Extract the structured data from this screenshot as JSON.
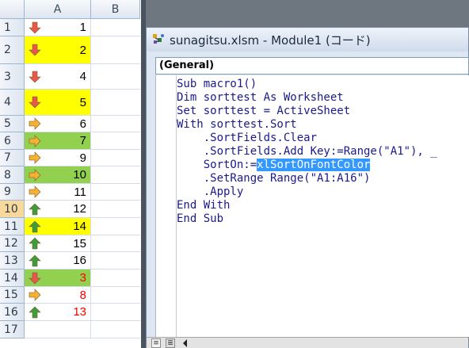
{
  "spreadsheet": {
    "corner": "",
    "columns": [
      "A",
      "B"
    ],
    "rows": [
      {
        "num": "1",
        "value": "1",
        "arrow": "down",
        "fill": "#ffffff",
        "color": "#000000"
      },
      {
        "num": "2",
        "value": "2",
        "arrow": "down",
        "fill": "#ffff00",
        "color": "#000000"
      },
      {
        "num": "3",
        "value": "4",
        "arrow": "down",
        "fill": "#ffffff",
        "color": "#000000"
      },
      {
        "num": "4",
        "value": "5",
        "arrow": "down",
        "fill": "#ffff00",
        "color": "#000000"
      },
      {
        "num": "5",
        "value": "6",
        "arrow": "right",
        "fill": "#ffffff",
        "color": "#000000"
      },
      {
        "num": "6",
        "value": "7",
        "arrow": "right",
        "fill": "#92d050",
        "color": "#000000"
      },
      {
        "num": "7",
        "value": "9",
        "arrow": "right",
        "fill": "#ffffff",
        "color": "#000000"
      },
      {
        "num": "8",
        "value": "10",
        "arrow": "right",
        "fill": "#92d050",
        "color": "#000000"
      },
      {
        "num": "9",
        "value": "11",
        "arrow": "right",
        "fill": "#ffffff",
        "color": "#000000"
      },
      {
        "num": "10",
        "value": "12",
        "arrow": "up",
        "fill": "#ffffff",
        "color": "#000000"
      },
      {
        "num": "11",
        "value": "14",
        "arrow": "up",
        "fill": "#ffff00",
        "color": "#000000"
      },
      {
        "num": "12",
        "value": "15",
        "arrow": "up",
        "fill": "#ffffff",
        "color": "#000000"
      },
      {
        "num": "13",
        "value": "16",
        "arrow": "up",
        "fill": "#ffffff",
        "color": "#000000"
      },
      {
        "num": "14",
        "value": "3",
        "arrow": "down",
        "fill": "#92d050",
        "color": "#ff0000"
      },
      {
        "num": "15",
        "value": "8",
        "arrow": "right",
        "fill": "#ffffff",
        "color": "#ff0000"
      },
      {
        "num": "16",
        "value": "13",
        "arrow": "up",
        "fill": "#ffffff",
        "color": "#ff0000"
      },
      {
        "num": "17",
        "value": "",
        "arrow": "",
        "fill": "#ffffff",
        "color": "#000000"
      }
    ],
    "active_row": "10",
    "arrow_colors": {
      "down": "#e8584a",
      "right": "#f6b032",
      "up": "#3f9c3a"
    }
  },
  "vbe": {
    "title": "sunagitsu.xlsm - Module1 (コード)",
    "icon": "vba-project-icon",
    "object_combo": "(General)",
    "code_lines": [
      "Sub macro1()",
      "Dim sorttest As Worksheet",
      "Set sorttest = ActiveSheet",
      "With sorttest.Sort",
      "    .SortFields.Clear",
      "    .SortFields.Add Key:=Range(\"A1\"), _",
      "    SortOn:=xlSortOnFontColor",
      "    .SetRange Range(\"A1:A16\")",
      "    .Apply",
      "End With",
      "End Sub"
    ],
    "selected": {
      "line_index": 6,
      "prefix": "    SortOn:=",
      "text": "xlSortOnFontColor"
    },
    "bottom_icons": [
      "procedure-view-icon",
      "full-module-view-icon",
      "scroll-left-icon"
    ]
  }
}
